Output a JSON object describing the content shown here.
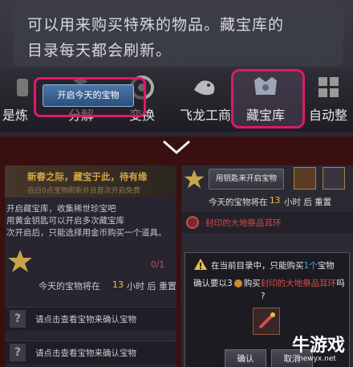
{
  "top": {
    "description_line1": "可以用来购买特殊的物品。藏宝库的",
    "description_line2": "目录每天都会刷新。",
    "menu": [
      {
        "label": "是炼",
        "icon": "refine-icon"
      },
      {
        "label": "分解",
        "icon": "hammer-icon"
      },
      {
        "label": "变换",
        "icon": "transform-icon"
      },
      {
        "label": "飞龙工商",
        "icon": "dragon-shop-icon"
      },
      {
        "label": "藏宝库",
        "icon": "treasure-chest-icon",
        "highlighted": true
      },
      {
        "label": "自动整",
        "icon": "grid-icon"
      }
    ]
  },
  "left": {
    "banner_title": "新春之际，藏宝于此，待有缘",
    "banner_sub": "自日0点宝物刷新并且首次开启免费",
    "lines": [
      "开启藏宝库，收集稀世珍宝吧",
      "用黄金钥匙可以开启多次藏宝库",
      "次开启后，只能选择用金币购买一个道具。"
    ],
    "open_button": "开启今天的宝物",
    "counter": "0/1",
    "reset_text": "今天的宝物将在",
    "reset_hours": "13",
    "reset_suffix": "小时 后  重置",
    "rows": [
      "请点击查看宝物来确认宝物",
      "请点击查看宝物来确认宝物"
    ]
  },
  "right": {
    "key_button": "用钥匙来开启宝物",
    "reset_text": "今天的宝物将在",
    "reset_hours": "13",
    "reset_suffix": "小时 后  重置",
    "item_name": "封印的大地祭品耳环",
    "dialog_line1_prefix": "在当前目录中，只能购买",
    "dialog_line1_count": "1个",
    "dialog_line1_suffix": "宝物",
    "dialog_line2_prefix": "确认要以3",
    "dialog_line2_mid": "购买",
    "dialog_line2_item": "封印的大地祭品耳环",
    "dialog_line2_suffix": "吗",
    "dialog_line3": "?",
    "confirm_button": "确认",
    "cancel_button": "取消"
  },
  "watermark": {
    "text": "牛游戏",
    "url": "newyx.net"
  },
  "colors": {
    "highlight": "#e0186e",
    "gold": "#d4a640",
    "item_red": "#e04848",
    "blue": "#4aa8e8"
  }
}
